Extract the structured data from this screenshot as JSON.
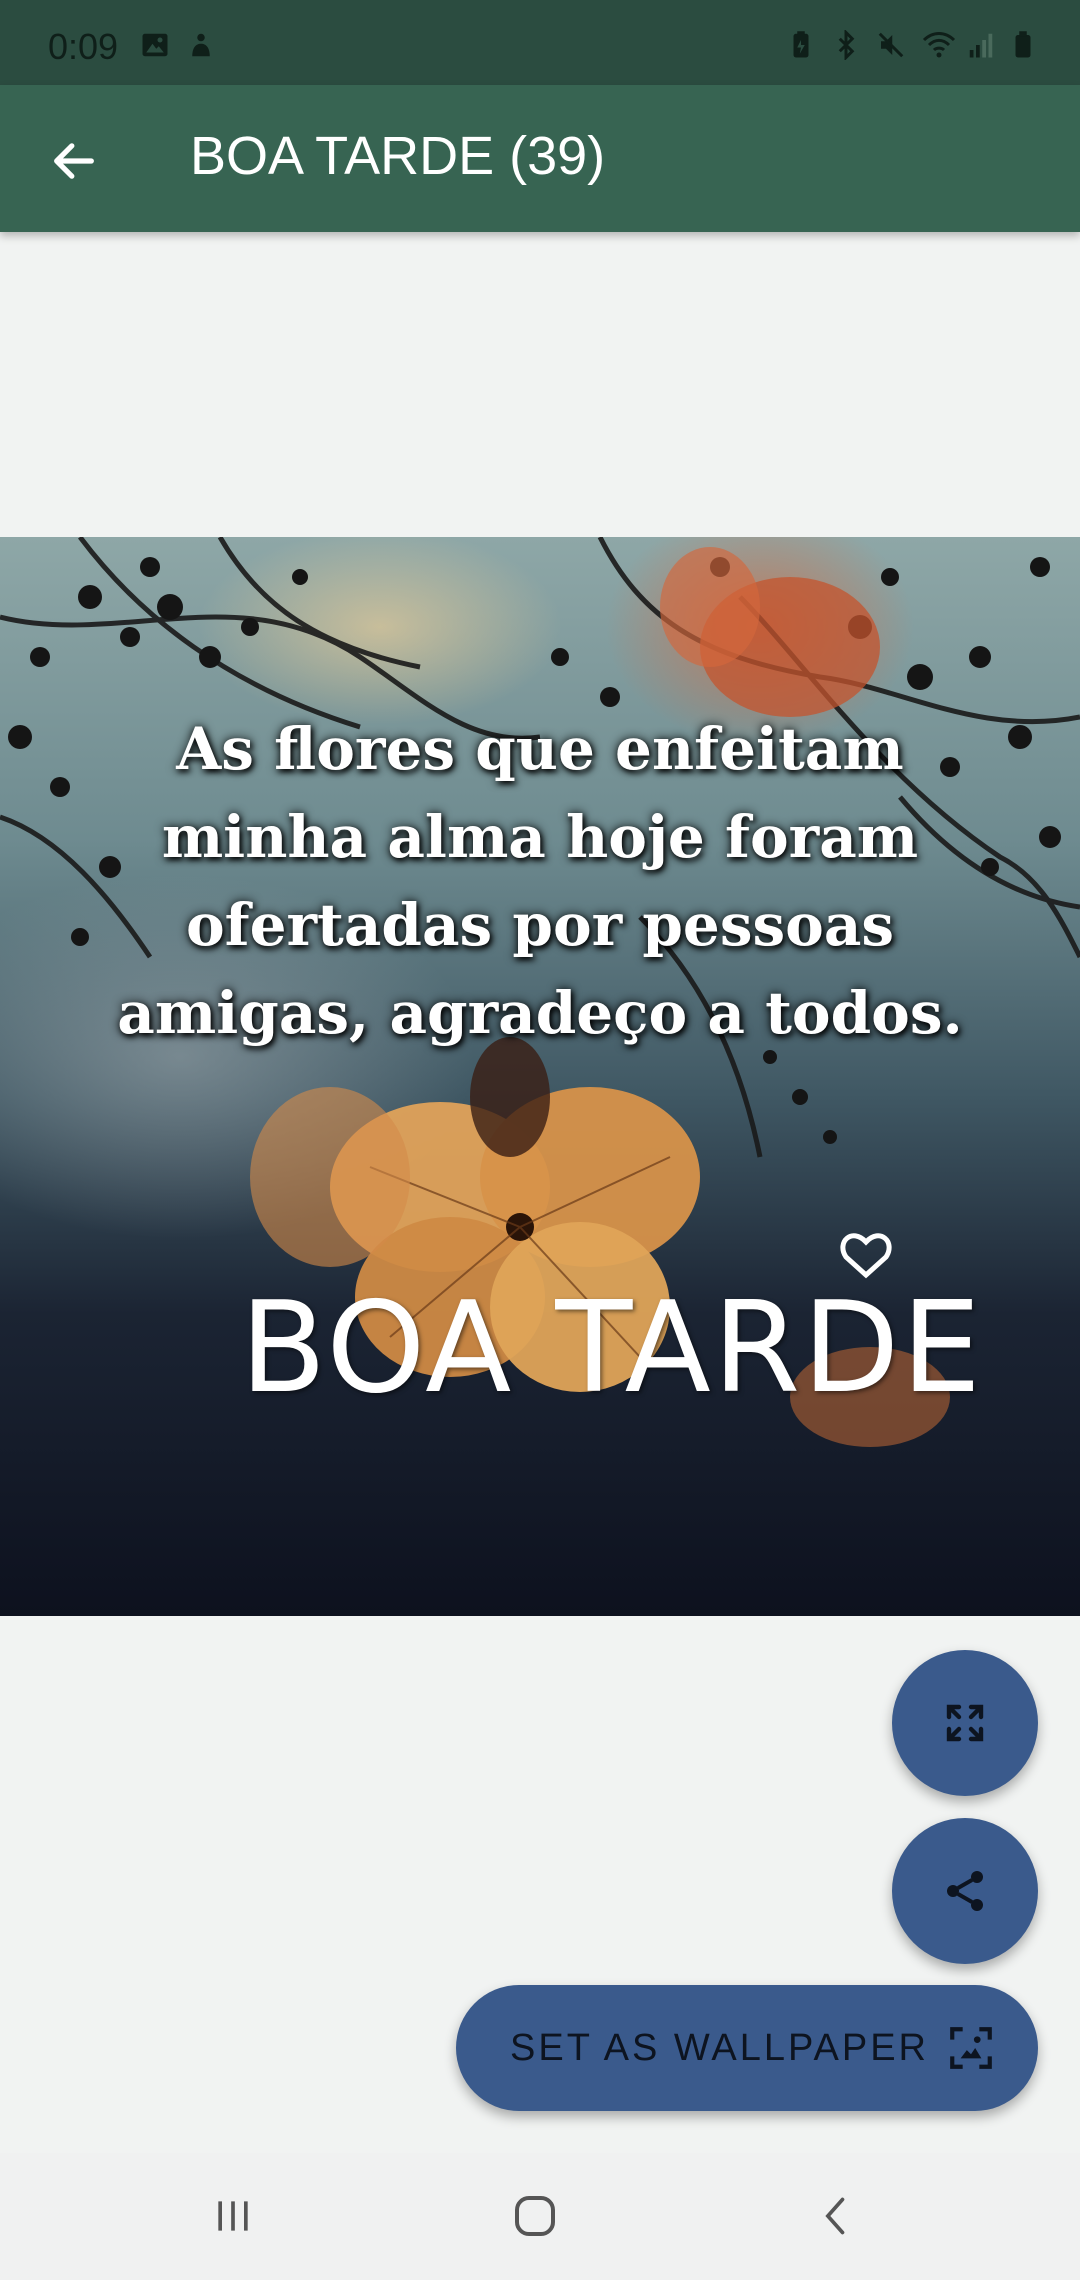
{
  "status_bar": {
    "time": "0:09",
    "left_icons": [
      "image-icon",
      "notification-app-icon"
    ],
    "right_icons": [
      "battery-saver-icon",
      "bluetooth-icon",
      "mute-icon",
      "wifi-icon",
      "signal-icon",
      "battery-icon"
    ]
  },
  "app_bar": {
    "title": "BOA TARDE (39)",
    "back_icon": "arrow-back-icon"
  },
  "image": {
    "quote_lines": [
      "As flores que enfeitam",
      "minha alma hoje foram",
      "ofertadas por pessoas",
      "amigas, agradeço a todos."
    ],
    "greeting": "BOA TARDE"
  },
  "actions": {
    "expand_icon": "fullscreen-icon",
    "share_icon": "share-icon",
    "wallpaper_label": "SET AS WALLPAPER",
    "wallpaper_icon": "wallpaper-icon"
  },
  "colors": {
    "status_bar": "#2b4c40",
    "app_bar": "#376452",
    "fab": "#3a5a8c",
    "background": "#f1f3f2"
  },
  "nav_bar": {
    "icons": [
      "recents-icon",
      "home-icon",
      "back-icon"
    ]
  }
}
